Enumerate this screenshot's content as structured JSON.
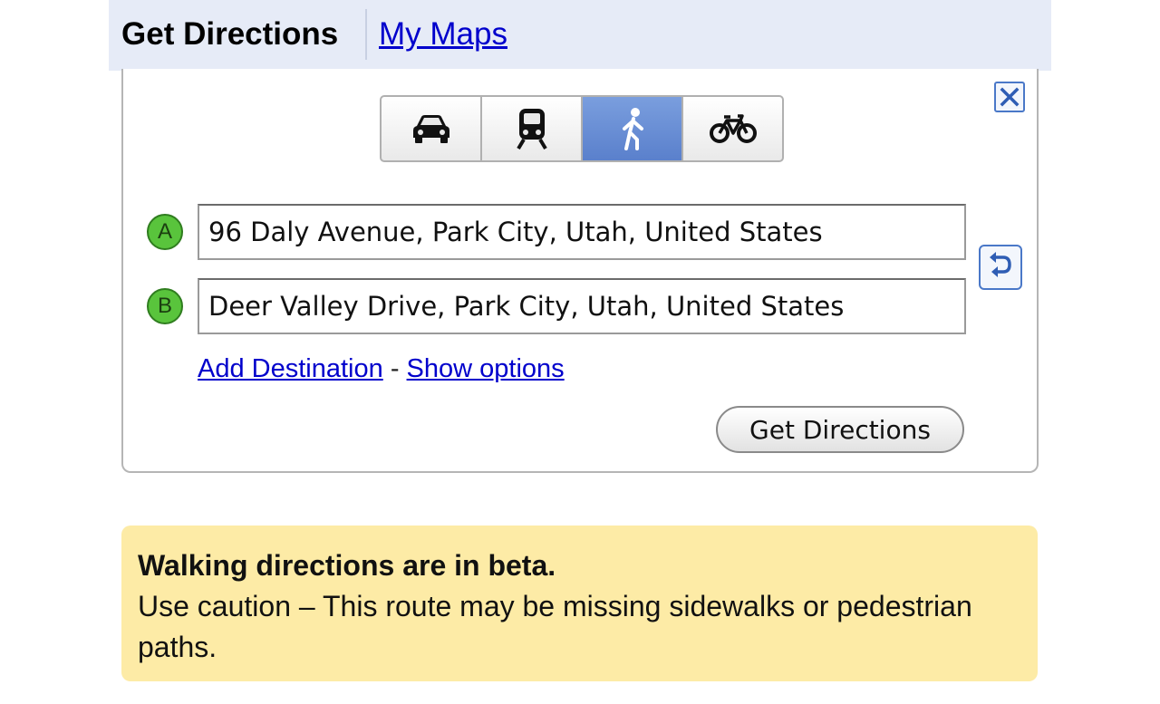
{
  "header": {
    "active_tab": "Get Directions",
    "link_tab": "My Maps"
  },
  "modes": [
    {
      "name": "driving",
      "icon": "car-icon",
      "active": false
    },
    {
      "name": "transit",
      "icon": "train-icon",
      "active": false
    },
    {
      "name": "walking",
      "icon": "walking-person-icon",
      "active": true
    },
    {
      "name": "bicycling",
      "icon": "bicycle-icon",
      "active": false
    }
  ],
  "route": {
    "start_marker": "A",
    "start_value": "96 Daly Avenue, Park City, Utah, United States",
    "end_marker": "B",
    "end_value": "Deer Valley Drive, Park City, Utah, United States"
  },
  "links": {
    "add_destination": "Add Destination",
    "separator": "-",
    "show_options": "Show options"
  },
  "get_directions_button": "Get Directions",
  "notice": {
    "title": "Walking directions are in beta.",
    "body": "Use caution – This route may be missing sidewalks or pedestrian paths."
  },
  "colors": {
    "header_bg": "#e6ebf7",
    "link": "#0000cc",
    "active_mode": "#6a8fd6",
    "marker_green": "#59c43c",
    "notice_bg": "#fdeba6"
  }
}
